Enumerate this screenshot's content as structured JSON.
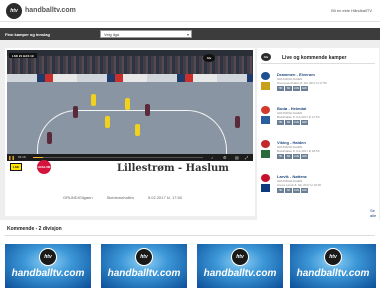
{
  "header": {
    "logo_glyph": "htv",
    "site_name": "handballtv.com",
    "login_label": "Bli en ekte HåndballTV"
  },
  "filter": {
    "label": "Finn kamper og innslag",
    "select_value": "Velg liga"
  },
  "video": {
    "scorebug": "LSK  21  HAS  19",
    "bug_glyph": "htv",
    "time_label": "01:19",
    "progress_fraction": 0.06
  },
  "match": {
    "home_logo_text": "LSK",
    "away_logo_text": "HASLUM",
    "title": "Lillestrøm - Haslum",
    "meta": [
      "GRUNDIGligaen",
      "Skedsmohallen",
      "5.02.2017 kl. 17:50"
    ]
  },
  "sidebar": {
    "logo_glyph": "htv",
    "title": "Live og kommende kamper",
    "items": [
      {
        "name": "Drammen - Elverum",
        "sub": "GRUNDIGLIGAEN",
        "date": "Drammenshallen 8. feb 2017 kl 17:50",
        "logo_color_a": "#1f4f8f",
        "logo_color_b": "#c9a01a"
      },
      {
        "name": "Bodø - Heimdal",
        "sub": "GRUNDIGLIGAEN",
        "date": "Bodøhallen 8. feb 2017 kl 17:50",
        "logo_color_a": "#d43a2c",
        "logo_color_b": "#2a5f9e"
      },
      {
        "name": "Viking - Halden",
        "sub": "GRUNDIGLIGAEN",
        "date": "Bodøhallen 8. feb 2017 kl 18:50",
        "logo_color_a": "#c12a2a",
        "logo_color_b": "#2d6a3b"
      },
      {
        "name": "Larvik - Nøtterø",
        "sub": "GRUNDIGLIGAEN",
        "date": "Arena Larvik 8. feb 2017 kl 18:30",
        "logo_color_a": "#c8102e",
        "logo_color_b": "#0b3a7e"
      }
    ],
    "badges": [
      "HD",
      "SD",
      "LIVE",
      "ARK"
    ],
    "more_label": "Se alle"
  },
  "coming": {
    "title": "Kommende - 2 divisjon",
    "thumbs": [
      {
        "glyph": "htv",
        "label": "handballtv.com"
      },
      {
        "glyph": "htv",
        "label": "handballtv.com"
      },
      {
        "glyph": "htv",
        "label": "handballtv.com"
      },
      {
        "glyph": "htv",
        "label": "handballtv.com"
      }
    ]
  },
  "colors": {
    "dark_bar": "#3c3c3c",
    "accent": "#f3b52a",
    "link_blue": "#224a80",
    "thumb_blue": "#0f67b6"
  }
}
